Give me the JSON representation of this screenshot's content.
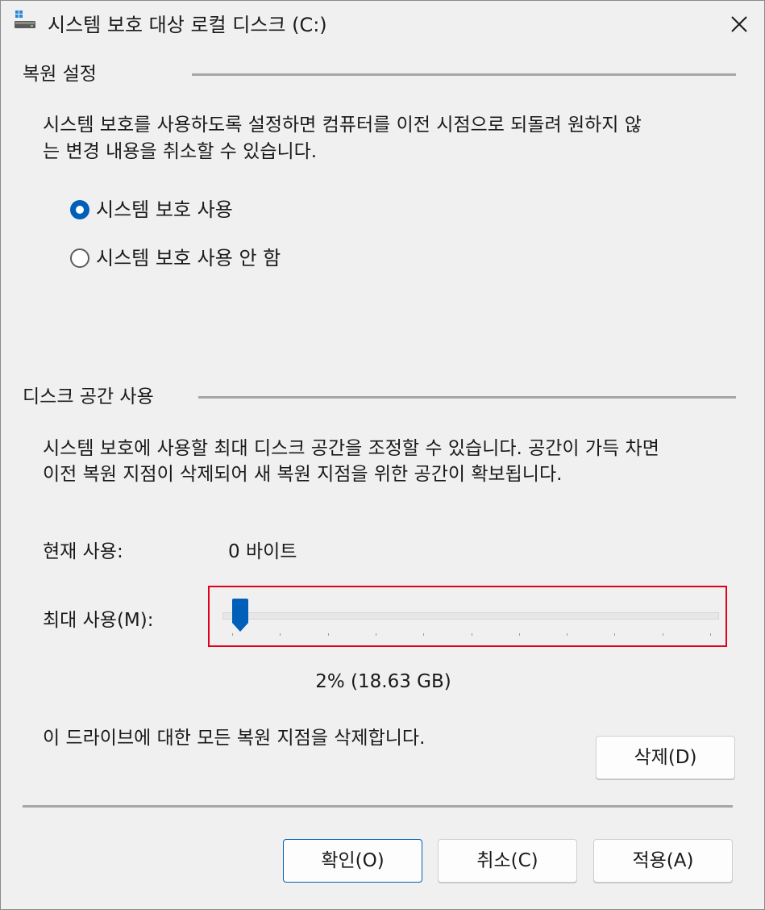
{
  "window": {
    "title": "시스템 보호 대상 로컬 디스크 (C:)",
    "accent_color": "#005fb8",
    "highlight_color": "#e0001a"
  },
  "restore_settings": {
    "header": "복원 설정",
    "description_line1": "시스템 보호를 사용하도록 설정하면 컴퓨터를 이전 시점으로 되돌려 원하지 않",
    "description_line2": "는 변경 내용을 취소할 수 있습니다.",
    "options": [
      {
        "label": "시스템 보호 사용",
        "checked": true
      },
      {
        "label": "시스템 보호 사용 안 함",
        "checked": false
      }
    ]
  },
  "disk_space": {
    "header": "디스크 공간 사용",
    "description_line1": "시스템 보호에 사용할 최대 디스크 공간을 조정할 수 있습니다. 공간이 가득 차면",
    "description_line2": "이전 복원 지점이 삭제되어 새 복원 지점을 위한 공간이 확보됩니다.",
    "current_usage_label": "현재 사용:",
    "current_usage_value": "0 바이트",
    "max_usage_label": "최대 사용(M):",
    "max_usage_percent": 2,
    "max_usage_text": "2% (18.63 GB)",
    "delete_text": "이 드라이브에 대한 모든 복원 지점을 삭제합니다.",
    "delete_button": "삭제(D)"
  },
  "footer": {
    "ok_button": "확인(O)",
    "cancel_button": "취소(C)",
    "apply_button": "적용(A)"
  }
}
